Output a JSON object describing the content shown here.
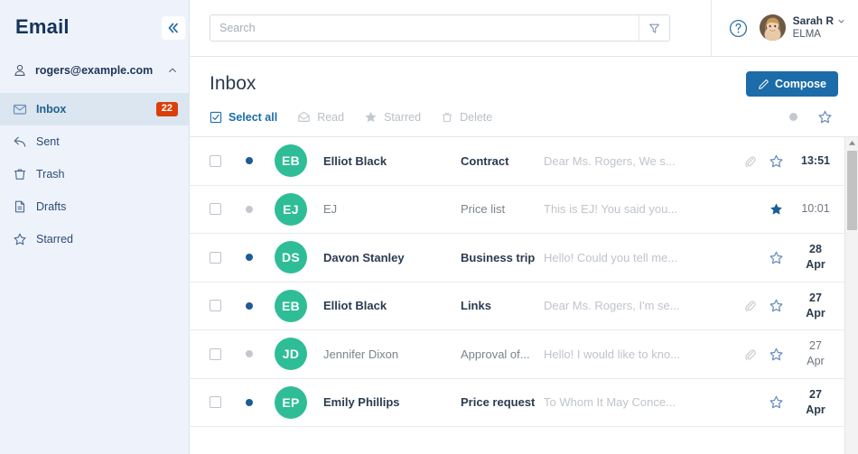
{
  "sidebar": {
    "brand": "Email",
    "collapse_icon": "chevrons-left-icon",
    "account": {
      "email": "rogers@example.com",
      "icon": "user-icon",
      "chevron": "chevron-up-icon"
    },
    "items": [
      {
        "label": "Inbox",
        "icon": "envelope-icon",
        "badge": "22",
        "active": true
      },
      {
        "label": "Sent",
        "icon": "sent-arrow-icon",
        "badge": "",
        "active": false
      },
      {
        "label": "Trash",
        "icon": "trash-icon",
        "badge": "",
        "active": false
      },
      {
        "label": "Drafts",
        "icon": "document-icon",
        "badge": "",
        "active": false
      },
      {
        "label": "Starred",
        "icon": "star-outline-icon",
        "badge": "",
        "active": false
      }
    ]
  },
  "topbar": {
    "search": {
      "value": "",
      "placeholder": "Search",
      "icon": "search-input"
    },
    "filter_icon": "funnel-filter-icon",
    "help_icon": "question-circle-icon",
    "user": {
      "name": "Sarah R",
      "org": "ELMA",
      "chevron": "chevron-down-icon",
      "avatar": "user-photo-avatar"
    }
  },
  "page": {
    "title": "Inbox",
    "compose_label": "Compose",
    "compose_icon": "pencil-icon",
    "compose_color": "#1b6ca8"
  },
  "actions": [
    {
      "label": "Select all",
      "icon": "checkbox-checked-icon",
      "state": "enabled"
    },
    {
      "label": "Read",
      "icon": "envelope-open-icon",
      "state": "disabled"
    },
    {
      "label": "Starred",
      "icon": "star-filled-icon",
      "state": "disabled"
    },
    {
      "label": "Delete",
      "icon": "trash-icon",
      "state": "disabled"
    }
  ],
  "column_headers": {
    "read_dot": "read-status-dot-icon",
    "star": "star-outline-icon"
  },
  "emails": [
    {
      "sender": "Elliot Black",
      "initials": "EB",
      "subject": "Contract",
      "preview": "Dear Ms. Rogers, We s...",
      "date1": "13:51",
      "date2": "",
      "unread": true,
      "starred": false,
      "attachment": true
    },
    {
      "sender": "EJ",
      "initials": "EJ",
      "subject": "Price list",
      "preview": "This is EJ! You said you...",
      "date1": "10:01",
      "date2": "",
      "unread": false,
      "starred": true,
      "attachment": false
    },
    {
      "sender": "Davon Stanley",
      "initials": "DS",
      "subject": "Business trip",
      "preview": "Hello! Could you tell me...",
      "date1": "28",
      "date2": "Apr",
      "unread": true,
      "starred": false,
      "attachment": false
    },
    {
      "sender": "Elliot Black",
      "initials": "EB",
      "subject": "Links",
      "preview": "Dear Ms. Rogers, I'm se...",
      "date1": "27",
      "date2": "Apr",
      "unread": true,
      "starred": false,
      "attachment": true
    },
    {
      "sender": "Jennifer Dixon",
      "initials": "JD",
      "subject": "Approval of...",
      "preview": "Hello! I would like to kno...",
      "date1": "27",
      "date2": "Apr",
      "unread": false,
      "starred": false,
      "attachment": true
    },
    {
      "sender": "Emily Phillips",
      "initials": "EP",
      "subject": "Price request",
      "preview": "To Whom It May Conce...",
      "date1": "27",
      "date2": "Apr",
      "unread": true,
      "starred": false,
      "attachment": false
    }
  ],
  "colors": {
    "avatar_green": "#2ebd97",
    "badge_red": "#d9400b",
    "accent_blue": "#1b6ca8",
    "sidebar_bg": "#eef3fb",
    "active_item_bg": "#dbe6f0"
  },
  "scrollbar": {
    "up_arrow": "scroll-up-arrow-icon",
    "thumb": "scroll-thumb"
  }
}
